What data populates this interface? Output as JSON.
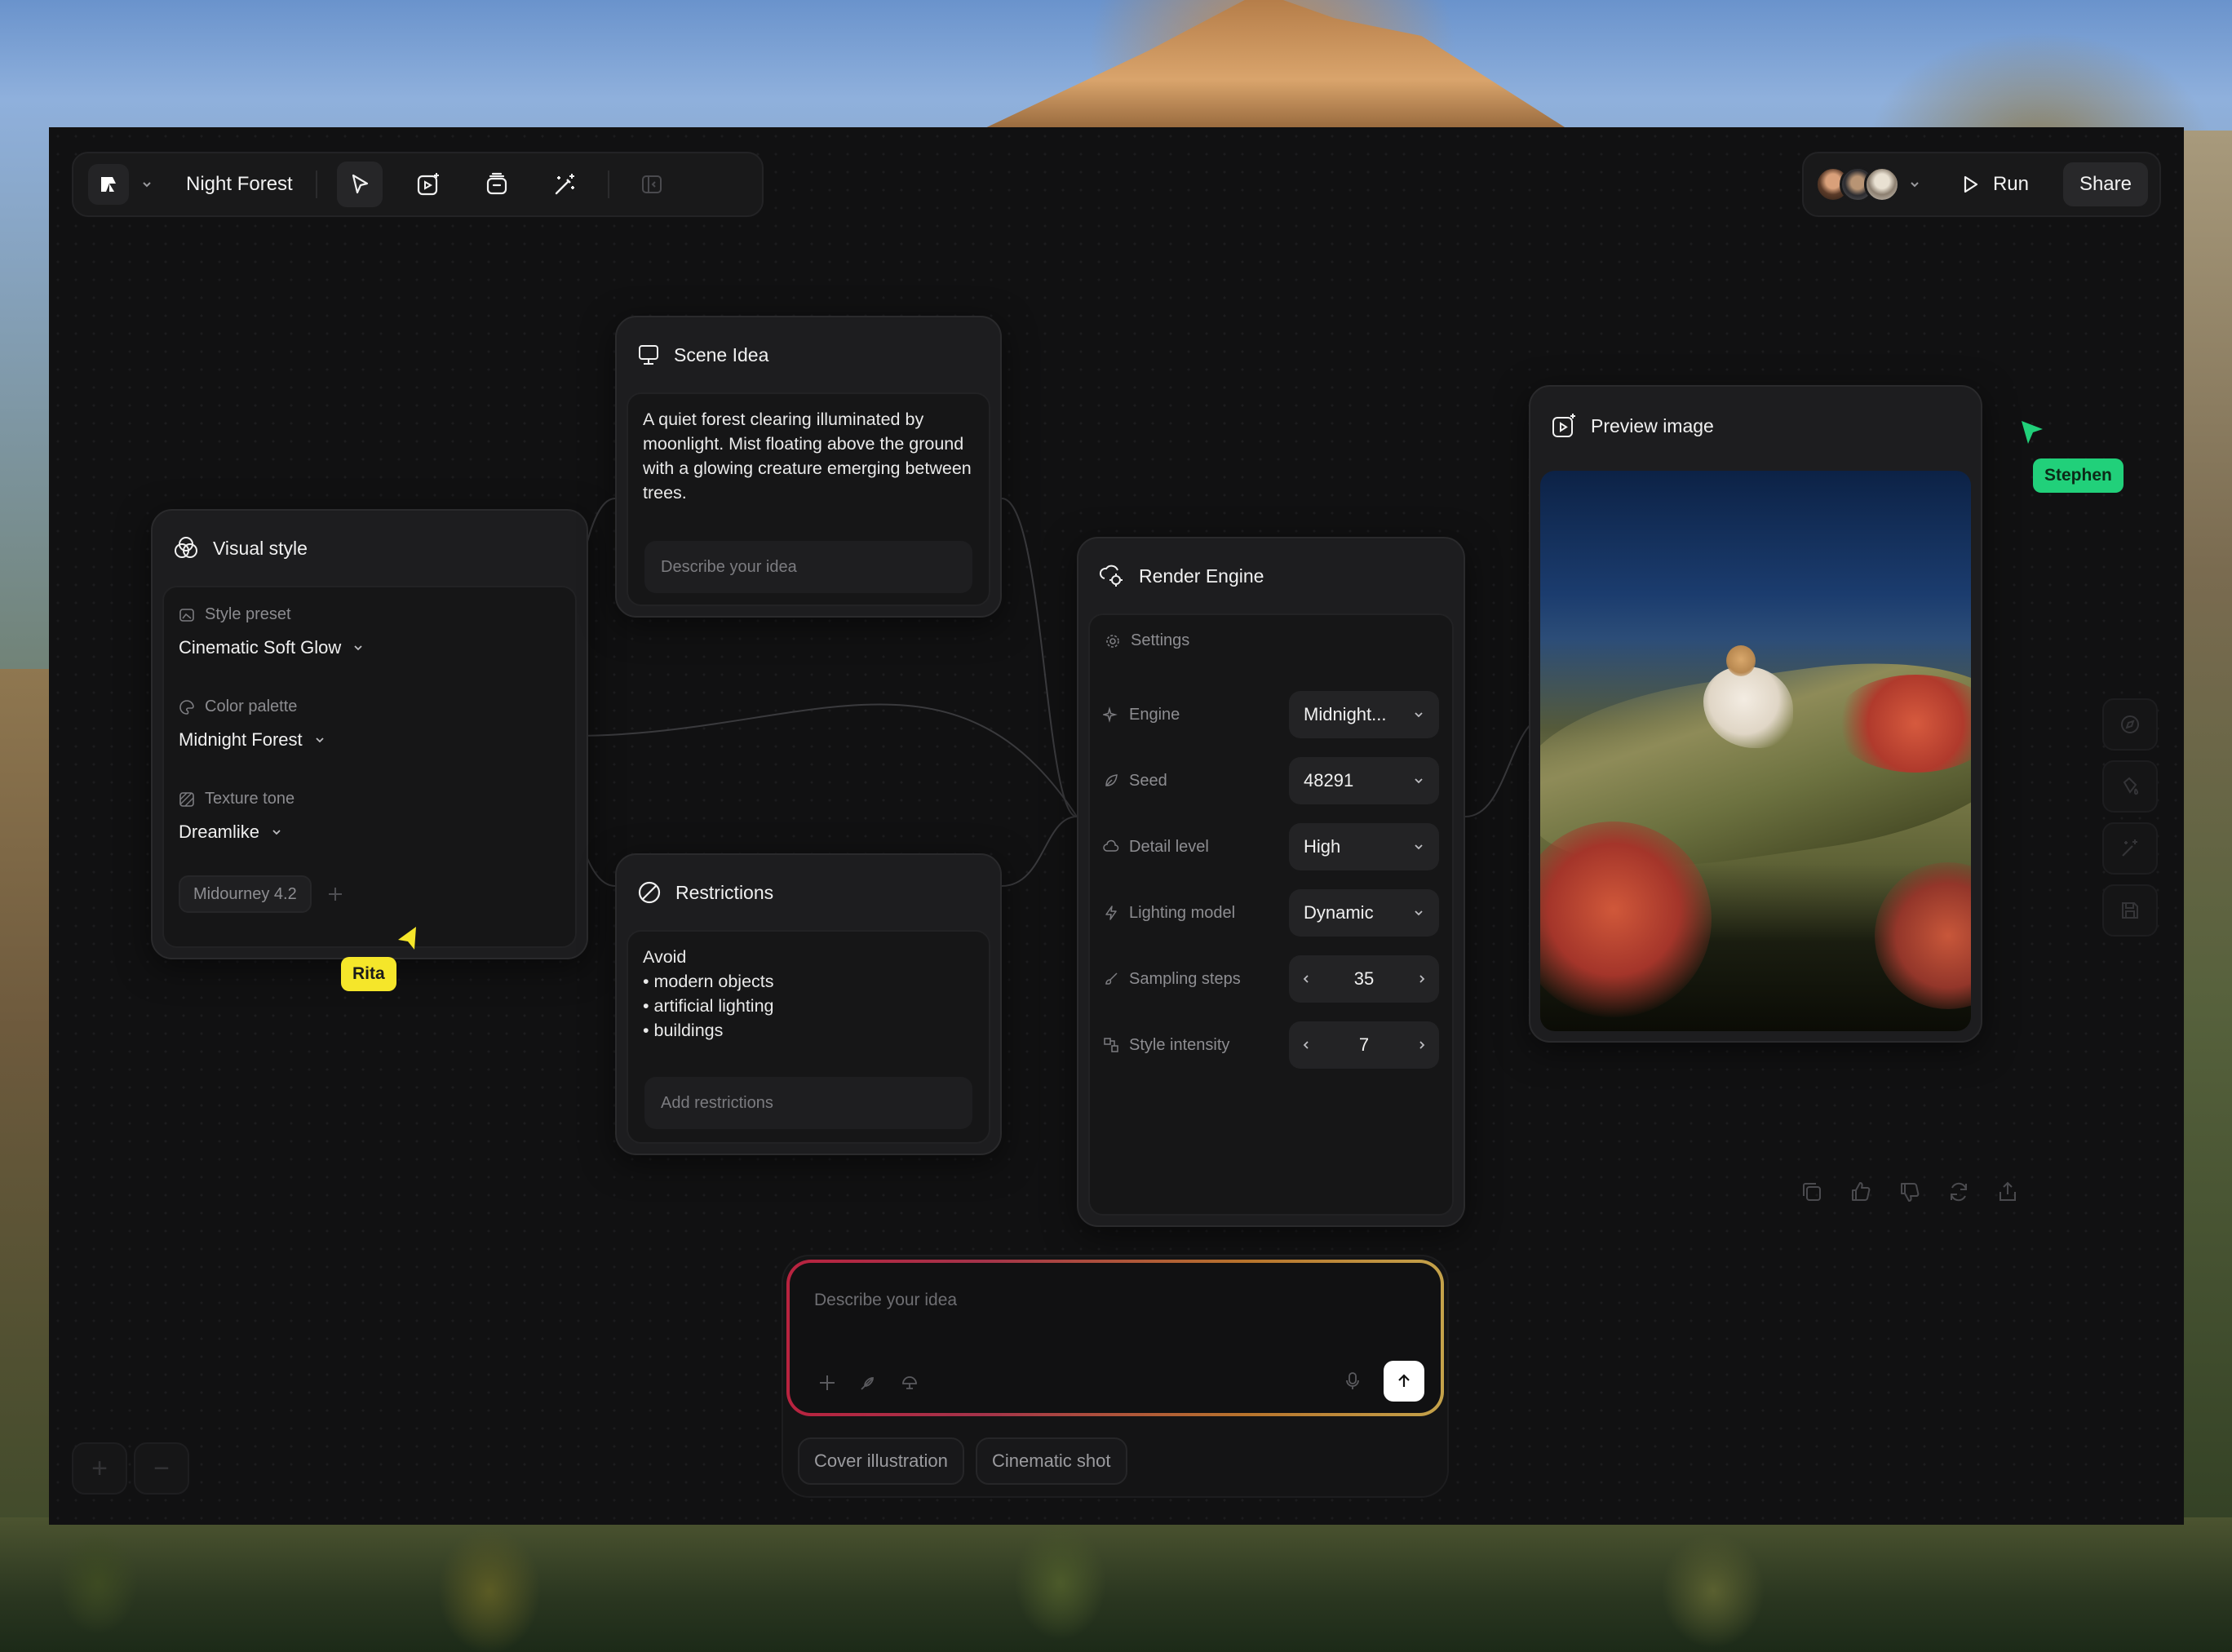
{
  "toolbar": {
    "project_title": "Night Forest",
    "tools": [
      "pointer-icon",
      "image-plus-icon",
      "layers-icon",
      "magic-wand-icon",
      "panel-icon"
    ],
    "run_label": "Run",
    "share_label": "Share"
  },
  "nodes": {
    "visual_style": {
      "title": "Visual style",
      "style_preset_label": "Style preset",
      "style_preset_value": "Cinematic Soft Glow",
      "color_palette_label": "Color palette",
      "color_palette_value": "Midnight Forest",
      "texture_tone_label": "Texture tone",
      "texture_tone_value": "Dreamlike",
      "model_tag": "Midourney 4.2"
    },
    "scene_idea": {
      "title": "Scene Idea",
      "text": "A quiet forest clearing illuminated by moonlight. Mist floating above the ground with a glowing creature emerging between trees.",
      "input_placeholder": "Describe your idea"
    },
    "restrictions": {
      "title": "Restrictions",
      "heading": "Avoid",
      "items": [
        "• modern objects",
        "• artificial lighting",
        "• buildings"
      ],
      "input_placeholder": "Add restrictions"
    },
    "render_engine": {
      "title": "Render Engine",
      "settings_label": "Settings",
      "engine_label": "Engine",
      "engine_value": "Midnight...",
      "seed_label": "Seed",
      "seed_value": "48291",
      "detail_label": "Detail level",
      "detail_value": "High",
      "lighting_label": "Lighting model",
      "lighting_value": "Dynamic",
      "steps_label": "Sampling steps",
      "steps_value": "35",
      "intensity_label": "Style intensity",
      "intensity_value": "7"
    },
    "preview": {
      "title": "Preview image"
    }
  },
  "cursors": {
    "rita": {
      "name": "Rita",
      "color": "#f5e62a"
    },
    "stephen": {
      "name": "Stephen",
      "color": "#21d07a"
    }
  },
  "prompt": {
    "placeholder": "Describe your idea",
    "suggestions": [
      "Cover illustration",
      "Cinematic shot"
    ]
  },
  "zoom": {
    "in": "+",
    "out": "−"
  }
}
